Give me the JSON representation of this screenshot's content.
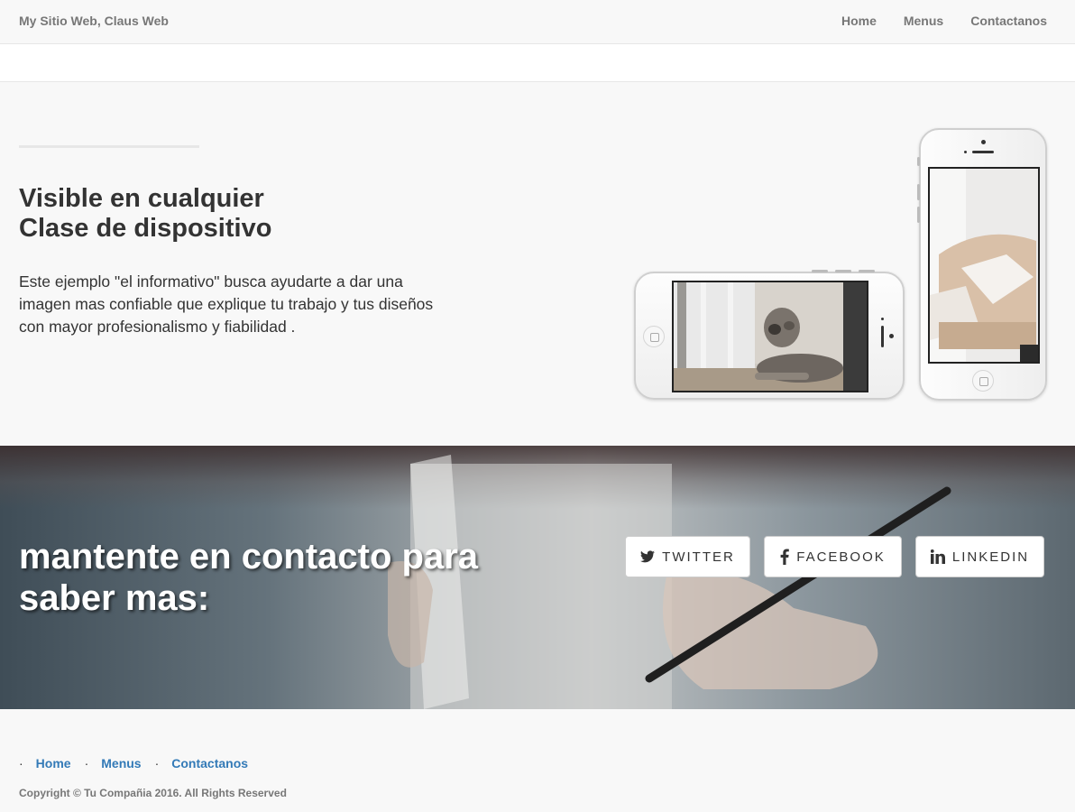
{
  "navbar": {
    "brand": "My Sitio Web, Claus Web",
    "links": [
      "Home",
      "Menus",
      "Contactanos"
    ]
  },
  "content": {
    "heading_line1": "Visible en cualquier",
    "heading_line2": "Clase de dispositivo",
    "lead": "Este ejemplo \"el informativo\" busca ayudarte a dar una imagen mas confiable que explique tu trabajo y tus diseños con mayor profesionalismo y fiabilidad ."
  },
  "banner": {
    "heading_line1": "mantente en contacto para",
    "heading_line2": "saber mas:",
    "social": {
      "twitter": "TWITTER",
      "facebook": "FACEBOOK",
      "linkedin": "LINKEDIN"
    }
  },
  "footer": {
    "links": [
      "Home",
      "Menus",
      "Contactanos"
    ],
    "separator": "·",
    "copyright": "Copyright © Tu Compañia 2016. All Rights Reserved"
  },
  "colors": {
    "link": "#337ab7",
    "nav_text": "#777777",
    "background": "#f8f8f8"
  }
}
